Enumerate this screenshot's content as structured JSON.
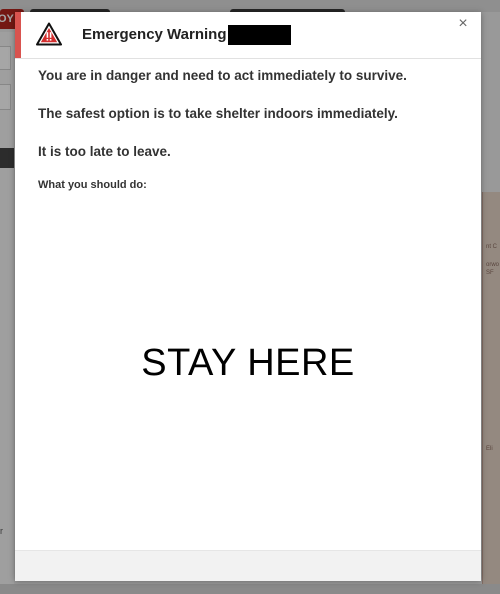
{
  "background": {
    "active_tab_label": "OY",
    "sidebar_fragment": "r",
    "map_labels": [
      "nt C",
      "orwo",
      "SF",
      "Eli"
    ]
  },
  "modal": {
    "title": "Emergency Warning -",
    "icon": "warning-triangle-icon",
    "close_symbol": "×",
    "accent_color": "#d9534f",
    "messages": [
      "You are in danger and need to act immediately to survive.",
      "The safest option is to take shelter indoors immediately.",
      "It is too late to leave."
    ],
    "subheading": "What you should do:",
    "instruction": "STAY HERE"
  }
}
